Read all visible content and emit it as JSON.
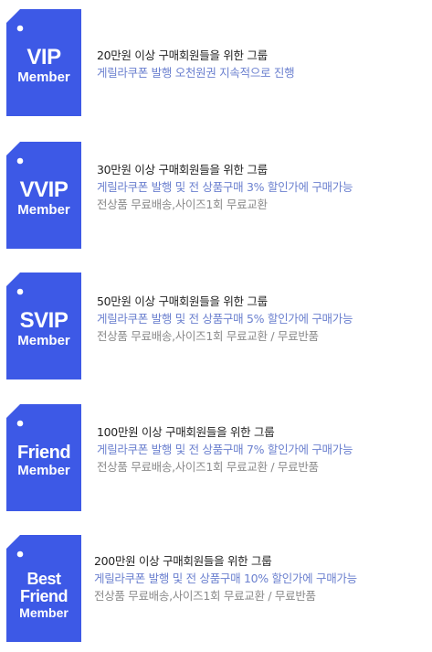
{
  "colors": {
    "tag_fill": "#3d59e6",
    "benefit_text": "#6b80cf",
    "extra_text": "#8a8a8a",
    "title_text": "#222222"
  },
  "tiers": [
    {
      "tag": [
        "VIP",
        "Member"
      ],
      "title": "20만원 이상 구매회원들을 위한 그룹",
      "benefit": "게릴라쿠폰 발행 오천원권 지속적으로 진행",
      "extra": ""
    },
    {
      "tag": [
        "VVIP",
        "Member"
      ],
      "title": "30만원 이상 구매회원들을 위한 그룹",
      "benefit": "게릴라쿠폰 발행 및 전 상품구매 3% 할인가에 구매가능",
      "extra": "전상품 무료배송,사이즈1회 무료교환"
    },
    {
      "tag": [
        "SVIP",
        "Member"
      ],
      "title": "50만원 이상 구매회원들을 위한 그룹",
      "benefit": "게릴라쿠폰 발행 및 전 상품구매 5% 할인가에 구매가능",
      "extra": "전상품 무료배송,사이즈1회 무료교환 / 무료반품"
    },
    {
      "tag": [
        "Friend",
        "Member"
      ],
      "title": "100만원 이상 구매회원들을 위한 그룹",
      "benefit": "게릴라쿠폰 발행 및 전 상품구매 7% 할인가에 구매가능",
      "extra": "전상품 무료배송,사이즈1회 무료교환 / 무료반품"
    },
    {
      "tag": [
        "Best",
        "Friend",
        "Member"
      ],
      "title": "200만원 이상 구매회원들을 위한 그룹",
      "benefit": "게릴라쿠폰 발행 및 전 상품구매 10% 할인가에 구매가능",
      "extra": "전상품 무료배송,사이즈1회 무료교환 / 무료반품"
    }
  ]
}
